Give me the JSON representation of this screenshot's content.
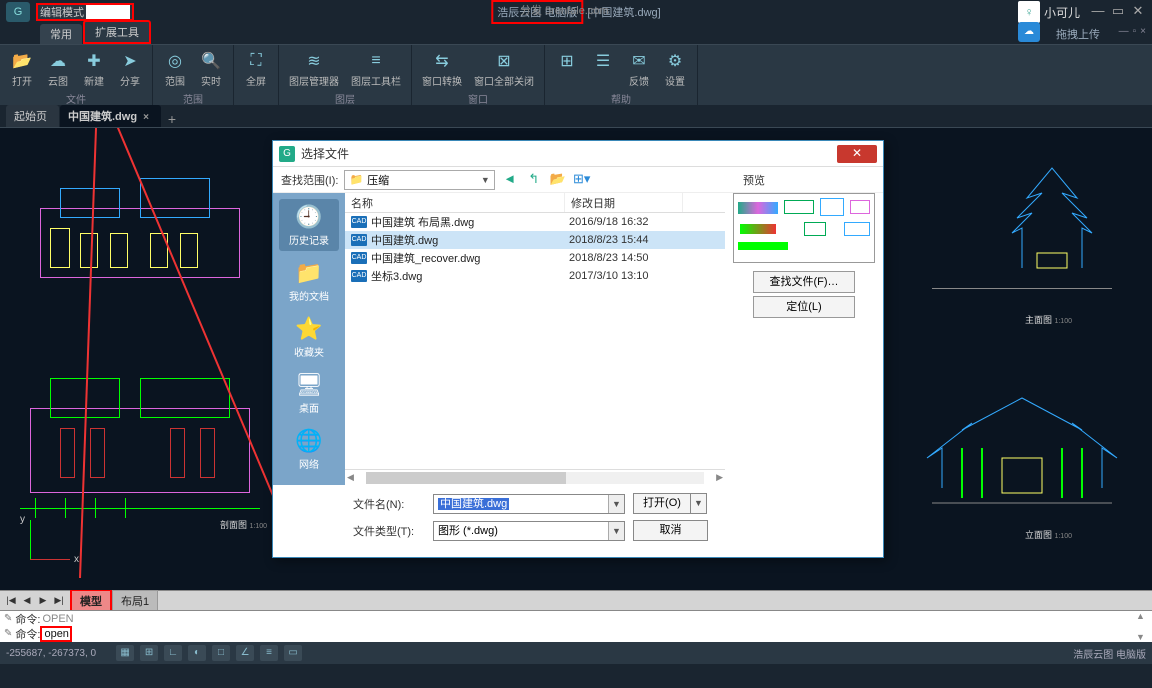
{
  "titlebar": {
    "edit_mode_label": "编辑模式",
    "app_name": "浩辰云图 电脑版",
    "doc_title": "[中国建筑.dwg]",
    "watermark": "分发 5renfale.com",
    "user_name": "小可儿",
    "upload_text": "拖拽上传"
  },
  "ribbon_tabs": {
    "t1": "常用",
    "t2": "扩展工具"
  },
  "ribbon": {
    "g1_title": "文件",
    "open": "打开",
    "cloud": "云图",
    "new": "新建",
    "share": "分享",
    "g2_title": "范围",
    "range": "范围",
    "realtime": "实时",
    "g3": "全屏",
    "g4_title": "图层",
    "layer_mgr": "图层管理器",
    "layer_tb": "图层工具栏",
    "g5_title": "窗口",
    "win_switch": "窗口转换",
    "win_closeall": "窗口全部关闭",
    "g6_title": "帮助",
    "tile": "",
    "feedback": "反馈",
    "settings": "设置"
  },
  "doc_tabs": {
    "start": "起始页",
    "doc1": "中国建筑.dwg"
  },
  "canvas": {
    "caption1": "剖面图",
    "caption2": "立面图",
    "caption3": "主面图",
    "scale": "1:100",
    "ucs_x": "x",
    "ucs_y": "y"
  },
  "layout_tabs": {
    "model": "模型",
    "layout1": "布局1"
  },
  "command": {
    "line1_prefix": "命令:",
    "line1_cmd": "OPEN",
    "line2_prefix": "命令:",
    "line2_cmd": "open"
  },
  "status": {
    "coords": "-255687, -267373, 0",
    "right_text": "浩辰云图 电脑版"
  },
  "dialog": {
    "title": "选择文件",
    "scope_label": "查找范围(I):",
    "folder": "压缩",
    "preview_label": "预览",
    "col_name": "名称",
    "col_date": "修改日期",
    "sidebar": {
      "history": "历史记录",
      "mydocs": "我的文档",
      "favorites": "收藏夹",
      "desktop": "桌面",
      "network": "网络"
    },
    "files": [
      {
        "name": "中国建筑 布局黑.dwg",
        "date": "2016/9/18 16:32"
      },
      {
        "name": "中国建筑.dwg",
        "date": "2018/8/23 15:44"
      },
      {
        "name": "中国建筑_recover.dwg",
        "date": "2018/8/23 14:50"
      },
      {
        "name": "坐标3.dwg",
        "date": "2017/3/10 13:10"
      }
    ],
    "btn_find": "查找文件(F)…",
    "btn_locate": "定位(L)",
    "filename_label": "文件名(N):",
    "filename_value": "中国建筑.dwg",
    "filetype_label": "文件类型(T):",
    "filetype_value": "图形 (*.dwg)",
    "btn_open": "打开(O)",
    "btn_cancel": "取消"
  },
  "icons": {
    "cad": "CAD"
  }
}
